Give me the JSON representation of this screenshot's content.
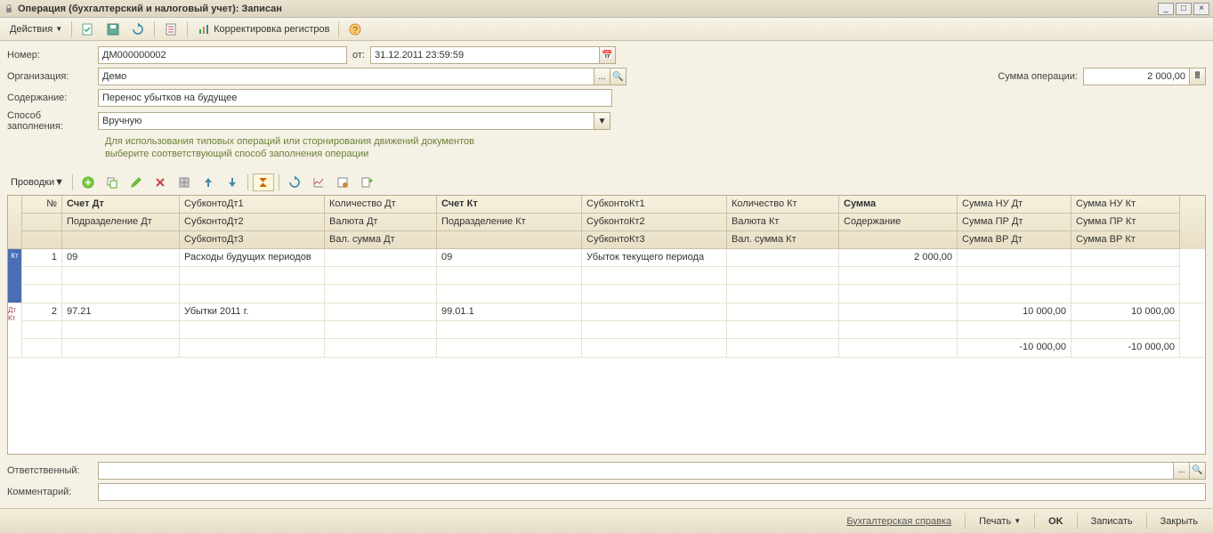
{
  "window": {
    "title": "Операция (бухгалтерский и налоговый учет): Записан"
  },
  "toolbar": {
    "actions": "Действия",
    "correction": "Корректировка регистров"
  },
  "form": {
    "number_label": "Номер:",
    "number_value": "ДМ000000002",
    "date_label": "от:",
    "date_value": "31.12.2011 23:59:59",
    "org_label": "Организация:",
    "org_value": "Демо",
    "sum_label": "Сумма операции:",
    "sum_value": "2 000,00",
    "content_label": "Содержание:",
    "content_value": "Перенос убытков на будущее",
    "method_label": "Способ заполнения:",
    "method_value": "Вручную",
    "hint_line1": "Для использования типовых операций или сторнирования движений документов",
    "hint_line2": "выберите соответствующий способ заполнения операции"
  },
  "grid_toolbar": {
    "entries": "Проводки"
  },
  "grid": {
    "headers": {
      "n": "№",
      "acct_dt": "Счет Дт",
      "division_dt": "Подразделение Дт",
      "subkonto_dt1": "СубконтоДт1",
      "subkonto_dt2": "СубконтоДт2",
      "subkonto_dt3": "СубконтоДт3",
      "qty_dt": "Количество Дт",
      "currency_dt": "Валюта Дт",
      "currsum_dt": "Вал. сумма Дт",
      "acct_kt": "Счет Кт",
      "division_kt": "Подразделение Кт",
      "subkonto_kt1": "СубконтоКт1",
      "subkonto_kt2": "СубконтоКт2",
      "subkonto_kt3": "СубконтоКт3",
      "qty_kt": "Количество Кт",
      "currency_kt": "Валюта Кт",
      "currsum_kt": "Вал. сумма Кт",
      "sum": "Сумма",
      "content": "Содержание",
      "sum_nu_dt": "Сумма НУ Дт",
      "sum_pr_dt": "Сумма ПР Дт",
      "sum_vr_dt": "Сумма ВР Дт",
      "sum_nu_kt": "Сумма НУ Кт",
      "sum_pr_kt": "Сумма ПР Кт",
      "sum_vr_kt": "Сумма ВР Кт"
    },
    "rows": [
      {
        "marker": "Кт",
        "n": "1",
        "acct_dt": "09",
        "sub_dt1": "Расходы будущих периодов",
        "acct_kt": "09",
        "sub_kt1": "Убыток текущего периода",
        "sum": "2 000,00"
      },
      {
        "marker": "Дт Кт",
        "n": "2",
        "acct_dt": "97.21",
        "sub_dt1": "Убытки 2011 г.",
        "acct_kt": "99.01.1",
        "sum_nu_dt": "10 000,00",
        "sum_nu_kt": "10 000,00",
        "sum_vr_dt": "-10 000,00",
        "sum_vr_kt": "-10 000,00"
      }
    ]
  },
  "bottom": {
    "responsible_label": "Ответственный:",
    "comment_label": "Комментарий:"
  },
  "footer": {
    "report": "Бухгалтерская справка",
    "print": "Печать",
    "ok": "OK",
    "save": "Записать",
    "close": "Закрыть"
  }
}
